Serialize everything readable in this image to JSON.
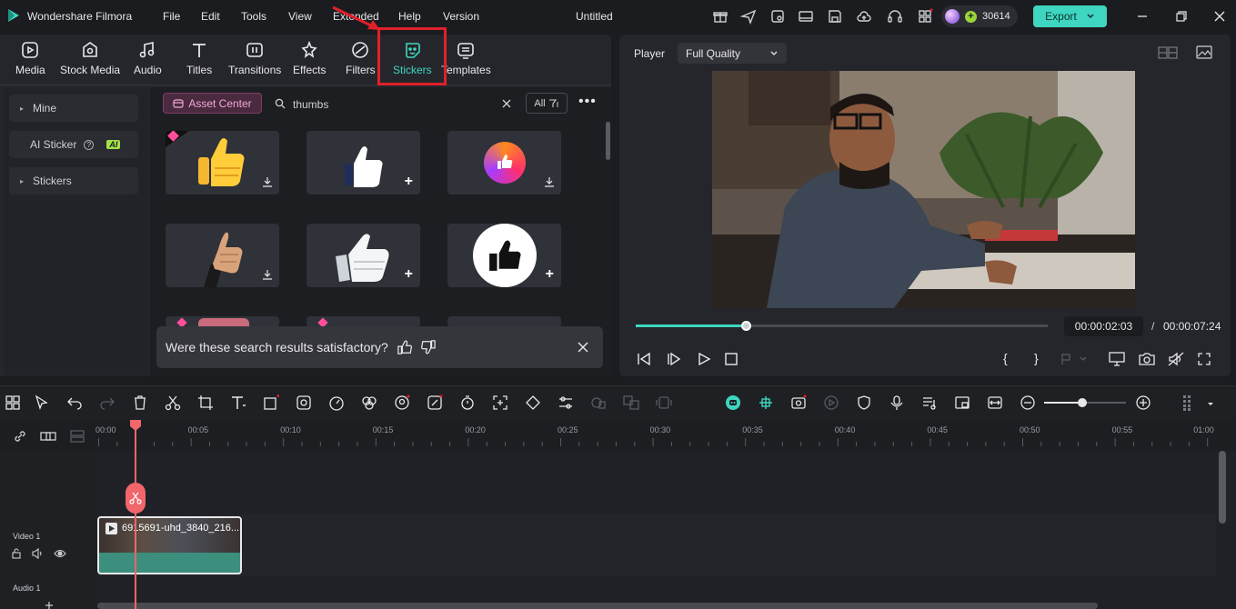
{
  "app": {
    "name": "Wondershare Filmora",
    "doc_title": "Untitled"
  },
  "menu": [
    "File",
    "Edit",
    "Tools",
    "View",
    "Extended",
    "Help",
    "Version"
  ],
  "credits": "30614",
  "export_label": "Export",
  "tabs": [
    "Media",
    "Stock Media",
    "Audio",
    "Titles",
    "Transitions",
    "Effects",
    "Filters",
    "Stickers",
    "Templates"
  ],
  "active_tab": "Stickers",
  "sidebar": {
    "mine": "Mine",
    "ai_sticker": "AI Sticker",
    "ai_badge": "AI",
    "stickers": "Stickers"
  },
  "search": {
    "asset_center": "Asset Center",
    "query": "thumbs",
    "filter_label": "All"
  },
  "feedback": {
    "question": "Were these search results satisfactory?"
  },
  "player": {
    "label": "Player",
    "quality": "Full Quality",
    "current_time": "00:00:02:03",
    "separator": "/",
    "total_time": "00:00:07:24",
    "progress": 0.27,
    "bracket_in": "{",
    "bracket_out": "}"
  },
  "ruler": [
    "00:00",
    "00:05",
    "00:10",
    "00:15",
    "00:20",
    "00:25",
    "00:30",
    "00:35",
    "00:40",
    "00:45",
    "00:50",
    "00:55",
    "01:00"
  ],
  "tracks": {
    "video": "Video 1",
    "audio": "Audio 1",
    "clip_name": "6915691-uhd_3840_216..."
  },
  "colors": {
    "accent": "#3ed6c0",
    "annotation": "#e0202a",
    "playhead": "#f0666a"
  }
}
